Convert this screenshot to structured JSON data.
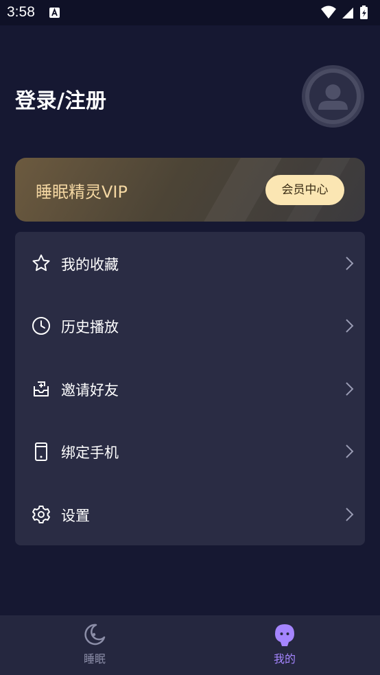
{
  "status_bar": {
    "time": "3:58"
  },
  "header": {
    "title": "登录/注册"
  },
  "vip": {
    "title": "睡眠精灵VIP",
    "button_label": "会员中心"
  },
  "menu": {
    "items": [
      {
        "label": "我的收藏",
        "icon": "star-icon"
      },
      {
        "label": "历史播放",
        "icon": "clock-icon"
      },
      {
        "label": "邀请好友",
        "icon": "inbox-invite-icon"
      },
      {
        "label": "绑定手机",
        "icon": "phone-icon"
      },
      {
        "label": "设置",
        "icon": "gear-icon"
      }
    ]
  },
  "bottom_nav": {
    "items": [
      {
        "label": "睡眠",
        "icon": "moon-icon",
        "active": false
      },
      {
        "label": "我的",
        "icon": "ghost-icon",
        "active": true
      }
    ]
  },
  "colors": {
    "background": "#161832",
    "card": "#2a2c44",
    "vip_text": "#f4d7a2",
    "vip_button": "#fbe6b3",
    "nav_active": "#a585ff",
    "nav_inactive": "#8c8ea8"
  }
}
